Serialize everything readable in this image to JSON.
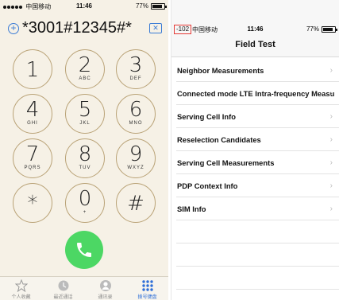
{
  "left_phone": {
    "status": {
      "carrier": "中国移动",
      "time": "11:46",
      "battery": "77%",
      "battery_level": 0.77
    },
    "number": "*3001#12345#*",
    "keys": [
      {
        "digit": "1",
        "letters": ""
      },
      {
        "digit": "2",
        "letters": "ABC"
      },
      {
        "digit": "3",
        "letters": "DEF"
      },
      {
        "digit": "4",
        "letters": "GHI"
      },
      {
        "digit": "5",
        "letters": "JKL"
      },
      {
        "digit": "6",
        "letters": "MNO"
      },
      {
        "digit": "7",
        "letters": "PQRS"
      },
      {
        "digit": "8",
        "letters": "TUV"
      },
      {
        "digit": "9",
        "letters": "WXYZ"
      },
      {
        "digit": "*",
        "letters": ""
      },
      {
        "digit": "0",
        "letters": "+"
      },
      {
        "digit": "#",
        "letters": ""
      }
    ],
    "tabs": [
      {
        "label": "个人收藏",
        "icon": "star-icon"
      },
      {
        "label": "最近通话",
        "icon": "clock-icon"
      },
      {
        "label": "通讯录",
        "icon": "contact-icon"
      },
      {
        "label": "拨号键盘",
        "icon": "keypad-icon"
      }
    ],
    "accent": "#3a7bd5",
    "call_color": "#4cd764"
  },
  "right_phone": {
    "status": {
      "signal_value": "-102",
      "carrier": "中国移动",
      "time": "11:46",
      "battery": "77%",
      "battery_level": 0.77
    },
    "title": "Field Test",
    "items": [
      "Neighbor Measurements",
      "Connected mode LTE Intra-frequency Measu",
      "Serving Cell Info",
      "Reselection Candidates",
      "Serving Cell Measurements",
      "PDP Context Info",
      "SIM Info"
    ],
    "highlight_color": "#e53935"
  }
}
